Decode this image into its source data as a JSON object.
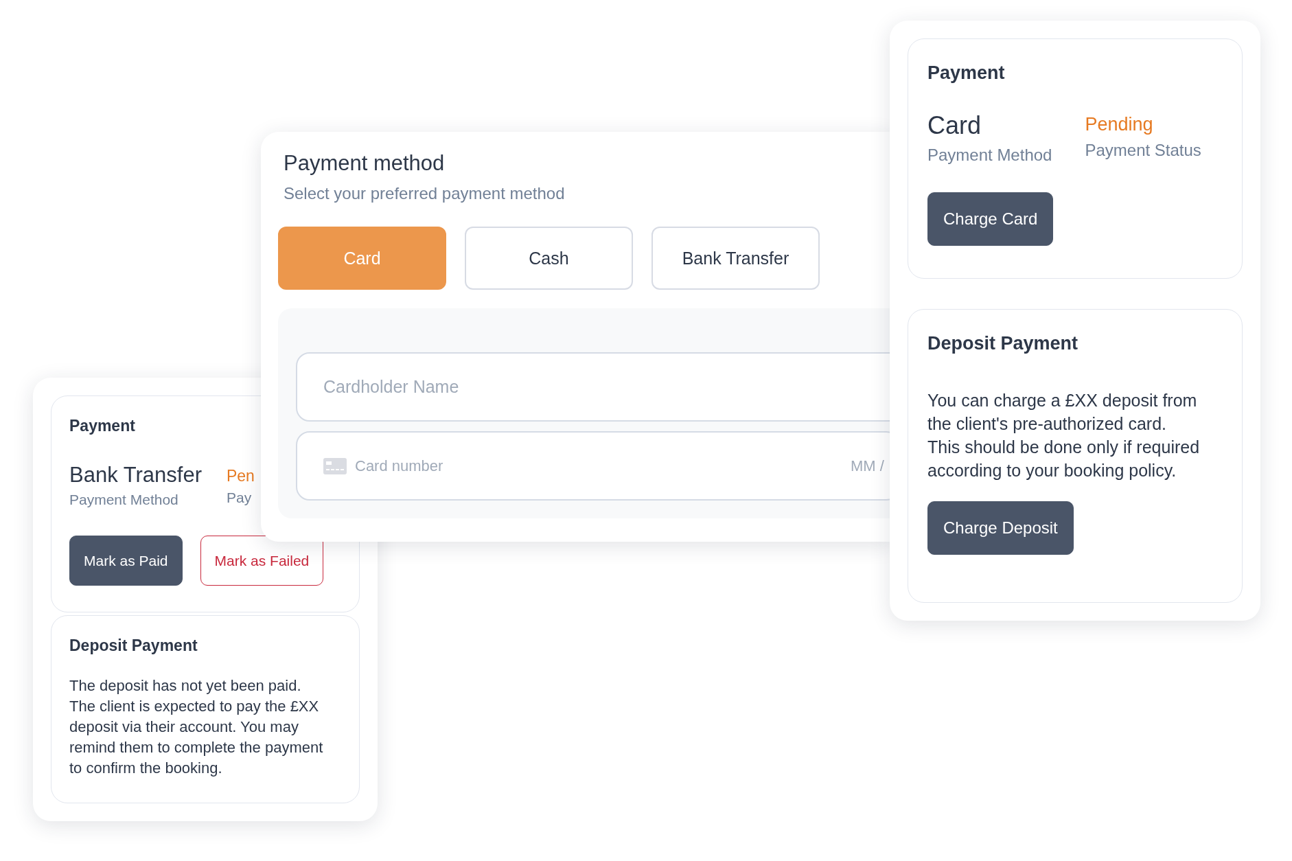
{
  "bank_transfer_card": {
    "payment": {
      "title": "Payment",
      "method": "Bank Transfer",
      "method_label": "Payment Method",
      "status": "Pen",
      "status_label": "Pay",
      "buttons": [
        {
          "label": "Mark as Paid",
          "kind": "primary"
        },
        {
          "label": "Mark as Failed",
          "kind": "danger"
        }
      ]
    },
    "deposit": {
      "title": "Deposit Payment",
      "text": "The deposit has not yet been paid. The client is expected to pay the £XX deposit via their account. You may remind them to complete the payment to confirm the booking."
    }
  },
  "payment_method_panel": {
    "title": "Payment method",
    "subtitle": "Select your preferred payment method",
    "tabs": [
      {
        "label": "Card",
        "selected": true
      },
      {
        "label": "Cash",
        "selected": false
      },
      {
        "label": "Bank Transfer",
        "selected": false
      }
    ],
    "cardholder_field": {
      "placeholder": "Cardholder Name"
    },
    "card_number_field": {
      "placeholder": "Card number",
      "expiry_placeholder": "MM /"
    }
  },
  "card_payment_card": {
    "payment": {
      "title": "Payment",
      "method": "Card",
      "method_label": "Payment Method",
      "status": "Pending",
      "status_label": "Payment Status",
      "buttons": [
        {
          "label": "Charge Card"
        }
      ]
    },
    "deposit": {
      "title": "Deposit Payment",
      "text": "You can charge a £XX deposit from the client's pre-authorized card. This should be done only if required according to your booking policy.",
      "buttons": [
        {
          "label": "Charge Deposit"
        }
      ]
    }
  }
}
